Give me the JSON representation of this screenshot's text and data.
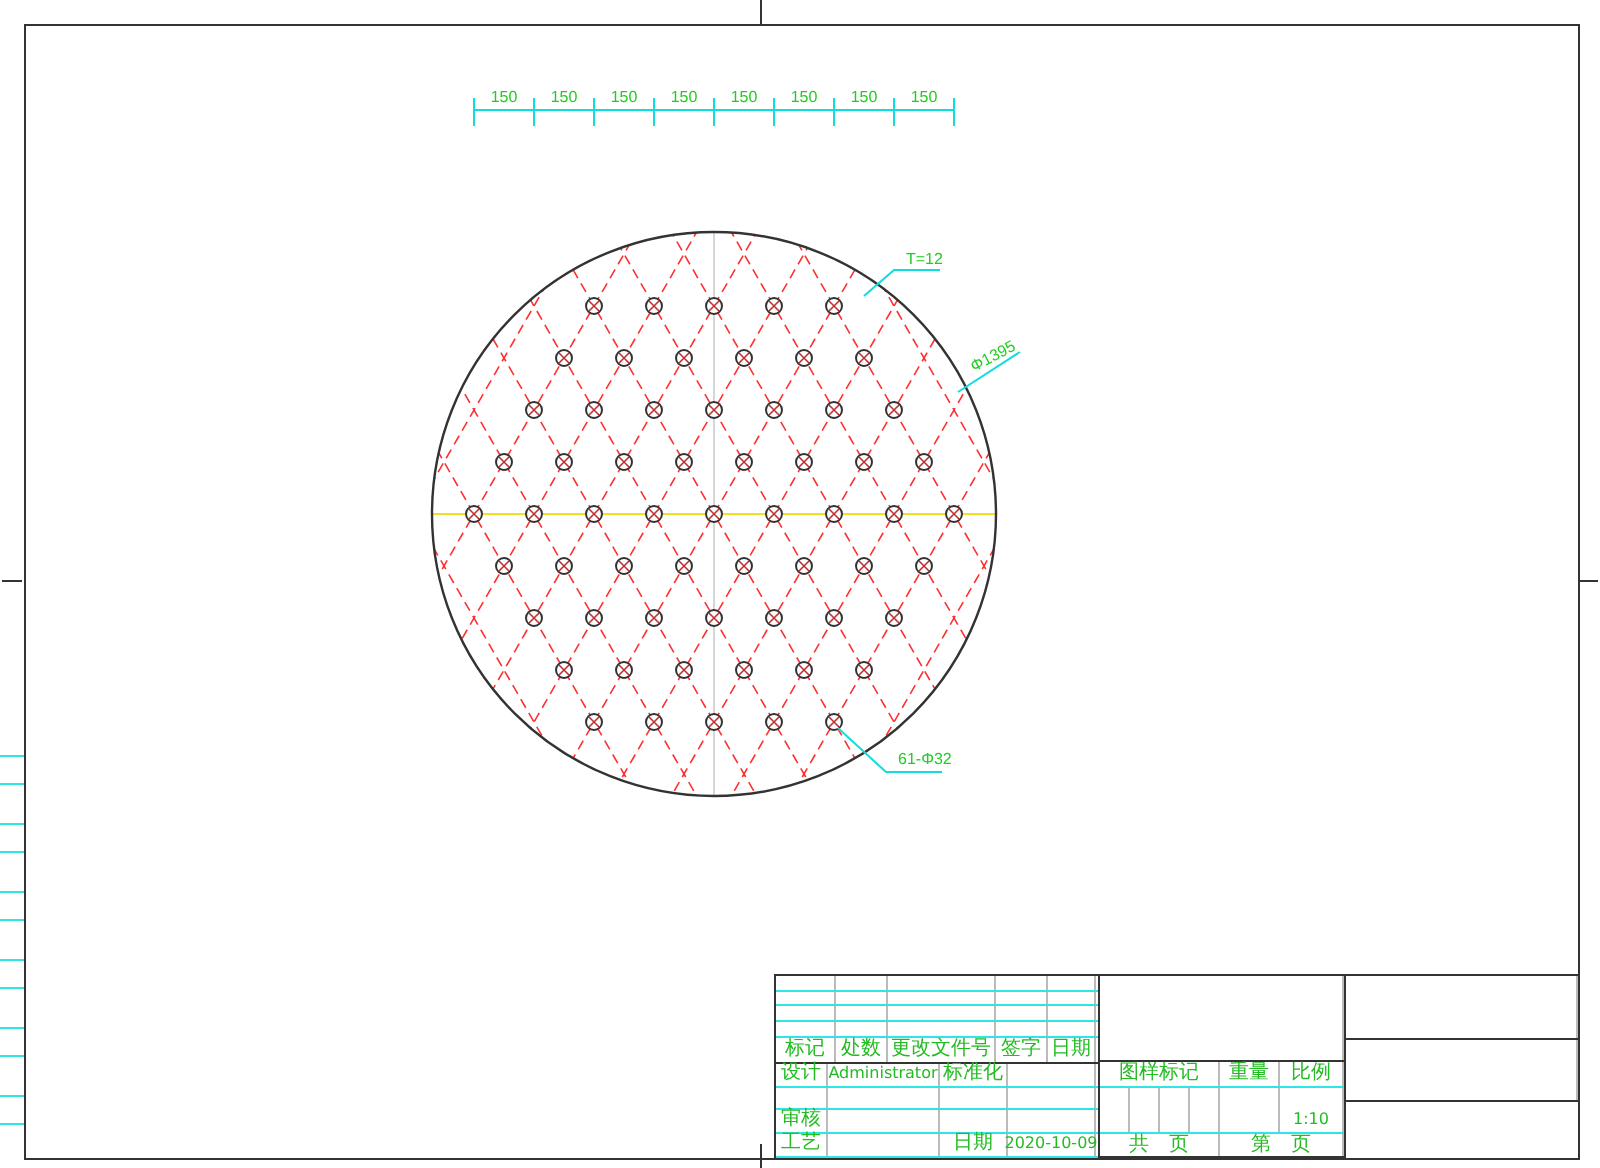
{
  "dimensions": {
    "segments": [
      "150",
      "150",
      "150",
      "150",
      "150",
      "150",
      "150",
      "150"
    ]
  },
  "annotations": {
    "thickness": "T=12",
    "diameter": "Φ1395",
    "holes": "61-Φ32"
  },
  "title_block": {
    "revision_headers": [
      "标记",
      "处数",
      "更改文件号",
      "签字",
      "日期"
    ],
    "sign_rows": [
      {
        "role": "设计",
        "name": "Administrator",
        "field": "标准化"
      },
      {
        "role": "审核"
      },
      {
        "role": "工艺",
        "field": "日期",
        "value": "2020-10-09"
      }
    ],
    "drawing_info": {
      "headers": [
        "图样标记",
        "重量",
        "比例"
      ],
      "scale": "1:10",
      "sheets": [
        "共   页",
        "第   页"
      ]
    }
  }
}
